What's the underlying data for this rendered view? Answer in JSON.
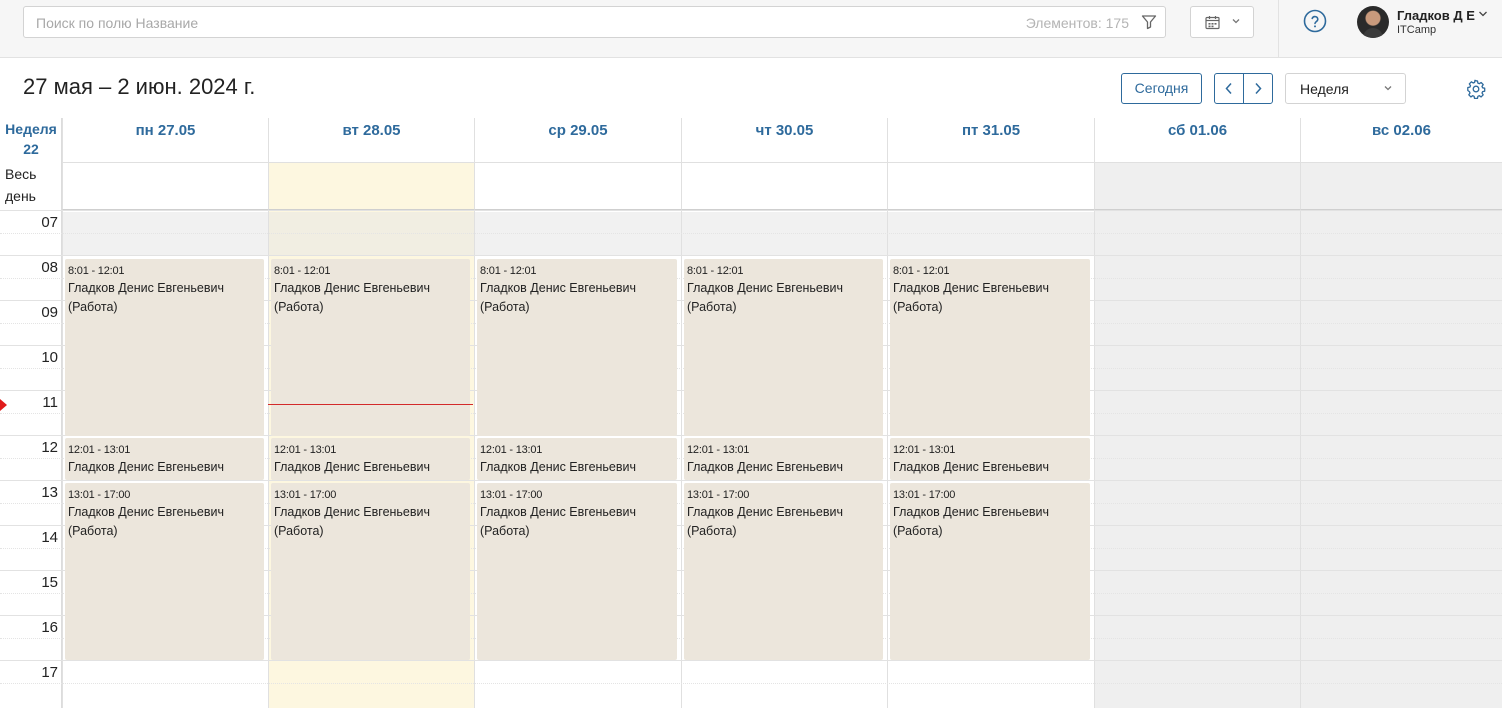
{
  "search": {
    "placeholder": "Поиск по полю Название",
    "count_text": "Элементов: 175"
  },
  "user": {
    "name": "Гладков Д Е",
    "company": "ITCamp"
  },
  "header": {
    "range": "27 мая – 2 июн. 2024 г.",
    "today_label": "Сегодня",
    "view_value": "Неделя"
  },
  "calendar": {
    "week_label": "Неделя",
    "week_number": "22",
    "allday_label": "Весь день",
    "days": [
      {
        "label": "пн 27.05",
        "weekend": false,
        "today": false
      },
      {
        "label": "вт 28.05",
        "weekend": false,
        "today": true
      },
      {
        "label": "ср 29.05",
        "weekend": false,
        "today": false
      },
      {
        "label": "чт 30.05",
        "weekend": false,
        "today": false
      },
      {
        "label": "пт 31.05",
        "weekend": false,
        "today": false
      },
      {
        "label": "сб 01.06",
        "weekend": true,
        "today": false
      },
      {
        "label": "вс 02.06",
        "weekend": true,
        "today": false
      }
    ],
    "hours": [
      "07",
      "08",
      "09",
      "10",
      "11",
      "12",
      "13",
      "14",
      "15",
      "16",
      "17"
    ],
    "events": [
      {
        "time": "8:01 - 12:01",
        "title": "Гладков Денис Евгеньевич (Работа)"
      },
      {
        "time": "12:01 - 13:01",
        "title": "Гладков Денис Евгеньевич (Обед)"
      },
      {
        "time": "13:01 - 17:00",
        "title": "Гладков Денис Евгеньевич (Работа)"
      }
    ]
  },
  "colors": {
    "accent": "#2e6a9c",
    "event_bg": "#ece6dc",
    "today_bg": "#fdf7e0",
    "weekend_bg": "#efefef",
    "now_line": "#d32a2a"
  }
}
